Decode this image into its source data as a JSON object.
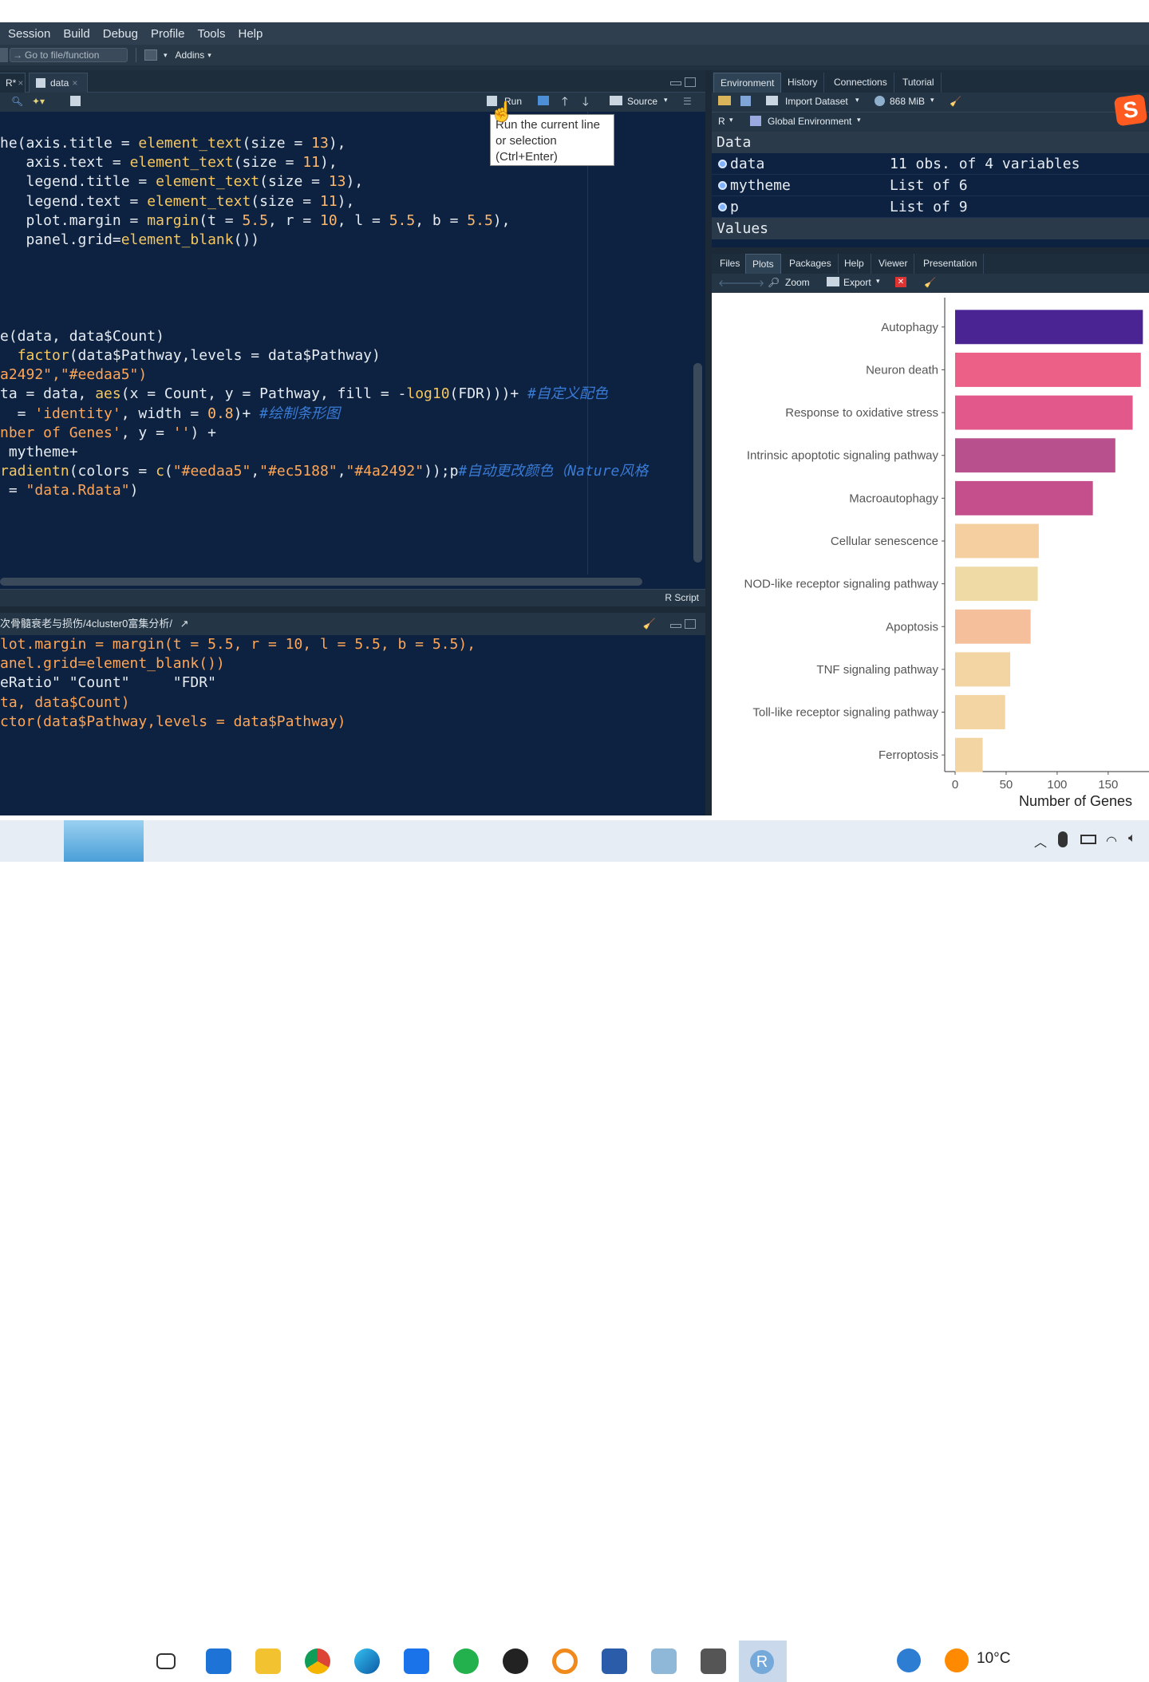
{
  "menu": [
    "Session",
    "Build",
    "Debug",
    "Profile",
    "Tools",
    "Help"
  ],
  "toolbar": {
    "goto_placeholder": "Go to file/function",
    "addins": "Addins"
  },
  "editor": {
    "tabs": [
      {
        "label": "R*"
      },
      {
        "label": "data"
      }
    ],
    "run_label": "Run",
    "source_label": "Source",
    "status_lang": "R Script",
    "tooltip": [
      "Run the current line",
      "or selection",
      "(Ctrl+Enter)"
    ],
    "code_lines": [
      [
        [
          "o",
          "he("
        ],
        [
          "o",
          "axis.title = "
        ],
        [
          "k",
          "element_text"
        ],
        [
          "o",
          "(size = "
        ],
        [
          "n",
          "13"
        ],
        [
          "o",
          "),"
        ]
      ],
      [
        [
          "o",
          "   axis.text = "
        ],
        [
          "k",
          "element_text"
        ],
        [
          "o",
          "(size = "
        ],
        [
          "n",
          "11"
        ],
        [
          "o",
          "),"
        ]
      ],
      [
        [
          "o",
          "   legend.title = "
        ],
        [
          "k",
          "element_text"
        ],
        [
          "o",
          "(size = "
        ],
        [
          "n",
          "13"
        ],
        [
          "o",
          "),"
        ]
      ],
      [
        [
          "o",
          "   legend.text = "
        ],
        [
          "k",
          "element_text"
        ],
        [
          "o",
          "(size = "
        ],
        [
          "n",
          "11"
        ],
        [
          "o",
          "),"
        ]
      ],
      [
        [
          "o",
          "   plot.margin = "
        ],
        [
          "k",
          "margin"
        ],
        [
          "o",
          "(t = "
        ],
        [
          "n",
          "5.5"
        ],
        [
          "o",
          ", r = "
        ],
        [
          "n",
          "10"
        ],
        [
          "o",
          ", l = "
        ],
        [
          "n",
          "5.5"
        ],
        [
          "o",
          ", b = "
        ],
        [
          "n",
          "5.5"
        ],
        [
          "o",
          "),"
        ]
      ],
      [
        [
          "o",
          "   panel.grid="
        ],
        [
          "k",
          "element_blank"
        ],
        [
          "o",
          "())"
        ]
      ],
      [
        [
          "o",
          ""
        ]
      ],
      [
        [
          "o",
          ""
        ]
      ],
      [
        [
          "o",
          ""
        ]
      ],
      [
        [
          "o",
          ""
        ]
      ],
      [
        [
          "o",
          "e(data, data$Count)"
        ]
      ],
      [
        [
          "o",
          "  "
        ],
        [
          "k",
          "factor"
        ],
        [
          "o",
          "(data$Pathway,levels = data$Pathway)"
        ]
      ],
      [
        [
          "s",
          "a2492\",\"#eedaa5\")"
        ]
      ],
      [
        [
          "o",
          "ta = data, "
        ],
        [
          "k",
          "aes"
        ],
        [
          "o",
          "(x = Count, y = Pathway, fill = -"
        ],
        [
          "k",
          "log10"
        ],
        [
          "o",
          "(FDR)))+ "
        ],
        [
          "c",
          "#自定义配色"
        ]
      ],
      [
        [
          "o",
          "  = "
        ],
        [
          "s",
          "'identity'"
        ],
        [
          "o",
          ", width = "
        ],
        [
          "n",
          "0.8"
        ],
        [
          "o",
          ")+ "
        ],
        [
          "c",
          "#绘制条形图"
        ]
      ],
      [
        [
          "s",
          "nber of Genes'"
        ],
        [
          "o",
          ", y = "
        ],
        [
          "s",
          "''"
        ],
        [
          "o",
          ") +"
        ]
      ],
      [
        [
          "o",
          " mytheme+"
        ]
      ],
      [
        [
          "k",
          "radientn"
        ],
        [
          "o",
          "(colors = "
        ],
        [
          "k",
          "c"
        ],
        [
          "o",
          "("
        ],
        [
          "s",
          "\"#eedaa5\""
        ],
        [
          "o",
          ","
        ],
        [
          "s",
          "\"#ec5188\""
        ],
        [
          "o",
          ","
        ],
        [
          "s",
          "\"#4a2492\""
        ],
        [
          "o",
          "));p"
        ],
        [
          "c",
          "#自动更改颜色（Nature风格"
        ]
      ],
      [
        [
          "o",
          " = "
        ],
        [
          "s",
          "\"data.Rdata\""
        ],
        [
          "o",
          ")"
        ]
      ]
    ]
  },
  "console": {
    "path": "次骨髓衰老与损伤/4cluster0富集分析/",
    "lines": [
      [
        [
          "s",
          "lot.margin = margin(t = 5.5, r = 10, l = 5.5, b = 5.5),"
        ]
      ],
      [
        [
          "s",
          "anel.grid=element_blank())"
        ]
      ],
      [
        [
          "o",
          ""
        ]
      ],
      [
        [
          "o",
          ""
        ]
      ],
      [
        [
          "o",
          "eRatio\" \"Count\"     \"FDR\""
        ]
      ],
      [
        [
          "o",
          ""
        ]
      ],
      [
        [
          "s",
          "ta, data$Count)"
        ]
      ],
      [
        [
          "s",
          "ctor(data$Pathway,levels = data$Pathway)"
        ]
      ]
    ]
  },
  "environment": {
    "tabs": [
      "Environment",
      "History",
      "Connections",
      "Tutorial"
    ],
    "import_label": "Import Dataset",
    "memory": "868 MiB",
    "lang": "R",
    "scope": "Global Environment",
    "data_header": "Data",
    "values_header": "Values",
    "rows": [
      {
        "name": "data",
        "value": "11 obs. of 4 variables"
      },
      {
        "name": "mytheme",
        "value": "List of  6"
      },
      {
        "name": "p",
        "value": "List of  9"
      }
    ]
  },
  "files": {
    "tabs": [
      "Files",
      "Plots",
      "Packages",
      "Help",
      "Viewer",
      "Presentation"
    ],
    "zoom_label": "Zoom",
    "export_label": "Export"
  },
  "chart_data": {
    "type": "bar",
    "orientation": "horizontal",
    "categories": [
      "Autophagy",
      "Neuron death",
      "Response to oxidative stress",
      "Intrinsic apoptotic signaling pathway",
      "Macroautophagy",
      "Cellular senescence",
      "NOD-like receptor signaling pathway",
      "Apoptosis",
      "TNF signaling pathway",
      "Toll-like receptor signaling pathway",
      "Ferroptosis"
    ],
    "values": [
      184,
      182,
      174,
      157,
      135,
      82,
      81,
      74,
      54,
      49,
      27
    ],
    "colors": [
      "#4a2492",
      "#ec5f86",
      "#e2588a",
      "#b8508e",
      "#c44f8c",
      "#f5cf9f",
      "#efdaa6",
      "#f5bf9c",
      "#f3d4a3",
      "#f3d4a3",
      "#f3d4a3"
    ],
    "xticks": [
      0,
      50,
      100,
      150
    ],
    "xlim": [
      0,
      190
    ],
    "xlabel": "Number of Genes",
    "ylabel": ""
  },
  "taskbar": {
    "temperature": "10°C"
  }
}
